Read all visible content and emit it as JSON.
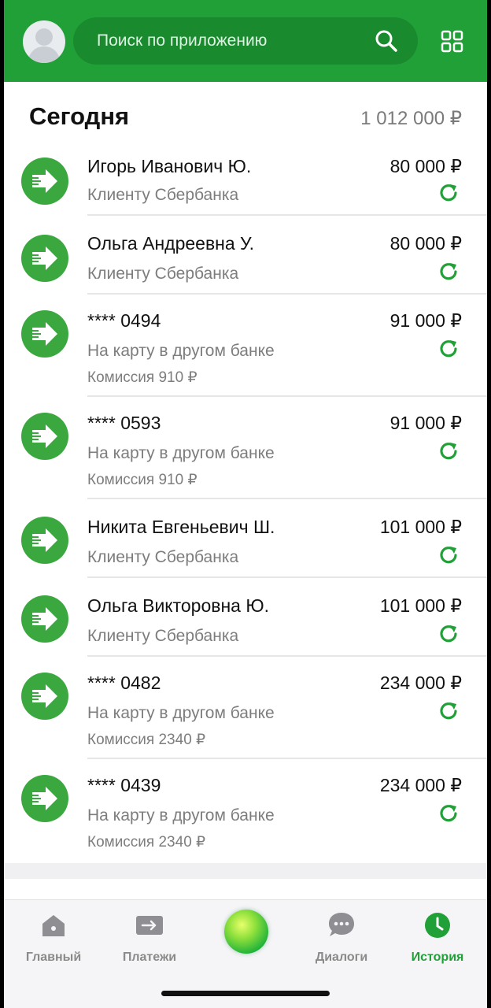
{
  "header": {
    "search_placeholder": "Поиск по приложению",
    "avatar_icon": "user-avatar",
    "search_icon": "search-icon",
    "menu_icon": "grid-icon"
  },
  "section": {
    "title": "Сегодня",
    "total": "1 012 000 ₽"
  },
  "transactions": [
    {
      "name": "Игорь Иванович Ю.",
      "type": "Клиенту Сбербанка",
      "amount": "80 000 ₽",
      "fee": ""
    },
    {
      "name": "Ольга Андреевна У.",
      "type": "Клиенту Сбербанка",
      "amount": "80 000 ₽",
      "fee": ""
    },
    {
      "name": "**** 0494",
      "type": "На карту в другом банке",
      "amount": "91 000 ₽",
      "fee": "Комиссия 910 ₽"
    },
    {
      "name": "**** 0593",
      "type": "На карту в другом банке",
      "amount": "91 000 ₽",
      "fee": "Комиссия 910 ₽"
    },
    {
      "name": "Никита Евгеньевич Ш.",
      "type": "Клиенту Сбербанка",
      "amount": "101 000 ₽",
      "fee": ""
    },
    {
      "name": "Ольга Викторовна Ю.",
      "type": "Клиенту Сбербанка",
      "amount": "101 000 ₽",
      "fee": ""
    },
    {
      "name": "**** 0482",
      "type": "На карту в другом банке",
      "amount": "234 000 ₽",
      "fee": "Комиссия 2340 ₽"
    },
    {
      "name": "**** 0439",
      "type": "На карту в другом банке",
      "amount": "234 000 ₽",
      "fee": "Комиссия 2340 ₽"
    }
  ],
  "bottom_nav": {
    "items": [
      {
        "label": "Главный",
        "icon": "home-icon"
      },
      {
        "label": "Платежи",
        "icon": "transfer-icon"
      },
      {
        "label": "Диалоги",
        "icon": "chat-icon"
      },
      {
        "label": "История",
        "icon": "clock-icon",
        "active": true
      }
    ]
  },
  "colors": {
    "brand_green": "#21a038",
    "icon_green": "#3aa83f"
  }
}
